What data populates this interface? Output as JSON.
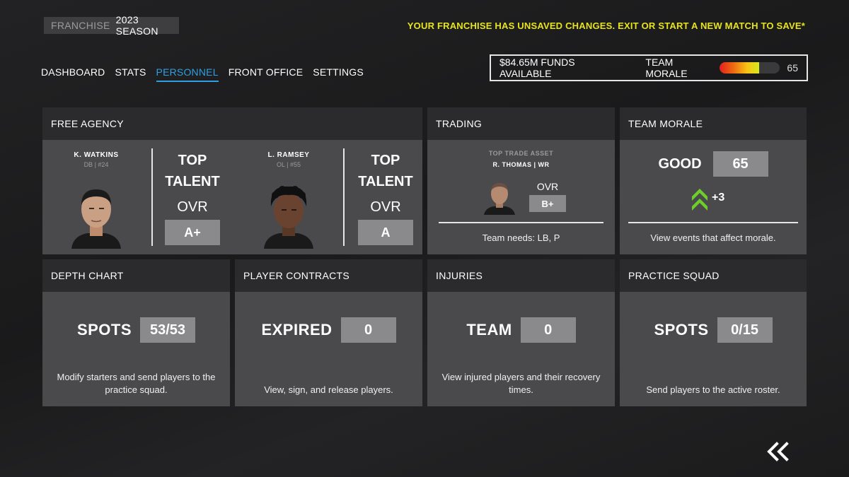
{
  "header": {
    "mode_label": "FRANCHISE",
    "season_label": "2023 SEASON",
    "warning": "YOUR FRANCHISE HAS UNSAVED CHANGES. EXIT OR START A NEW MATCH TO SAVE*"
  },
  "nav": {
    "tabs": [
      {
        "label": "DASHBOARD",
        "active": false
      },
      {
        "label": "STATS",
        "active": false
      },
      {
        "label": "PERSONNEL",
        "active": true
      },
      {
        "label": "FRONT OFFICE",
        "active": false
      },
      {
        "label": "SETTINGS",
        "active": false
      }
    ]
  },
  "status": {
    "funds": "$84.65M FUNDS AVAILABLE",
    "morale_label": "TEAM MORALE",
    "morale_value": "65",
    "morale_fraction": 0.65
  },
  "free_agency": {
    "title": "FREE AGENCY",
    "players": [
      {
        "name": "K. WATKINS",
        "pos": "DB | #24",
        "talent_line1": "TOP",
        "talent_line2": "TALENT",
        "ovr_label": "OVR",
        "grade": "A+"
      },
      {
        "name": "L. RAMSEY",
        "pos": "OL | #55",
        "talent_line1": "TOP",
        "talent_line2": "TALENT",
        "ovr_label": "OVR",
        "grade": "A"
      }
    ]
  },
  "trading": {
    "title": "TRADING",
    "top_asset_label": "TOP TRADE ASSET",
    "asset_name": "R. THOMAS | WR",
    "ovr_label": "OVR",
    "grade": "B+",
    "needs": "Team needs: LB, P"
  },
  "team_morale": {
    "title": "TEAM MORALE",
    "status": "GOOD",
    "value": "65",
    "change": "+3",
    "desc": "View events that affect morale."
  },
  "depth_chart": {
    "title": "DEPTH CHART",
    "label": "SPOTS",
    "value": "53/53",
    "desc": "Modify starters and send players to the practice squad."
  },
  "player_contracts": {
    "title": "PLAYER CONTRACTS",
    "label": "EXPIRED",
    "value": "0",
    "desc": "View, sign, and release players."
  },
  "injuries": {
    "title": "INJURIES",
    "label": "TEAM",
    "value": "0",
    "desc": "View injured players and their recovery times."
  },
  "practice_squad": {
    "title": "PRACTICE SQUAD",
    "label": "SPOTS",
    "value": "0/15",
    "desc": "Send players to the active roster."
  },
  "icons": {
    "back": "double-chevron-left-icon",
    "morale_up": "double-chevron-up-icon"
  },
  "colors": {
    "accent_blue": "#2f9fe3",
    "warning_yellow": "#e8e41c",
    "morale_green": "#6fcf2a"
  }
}
